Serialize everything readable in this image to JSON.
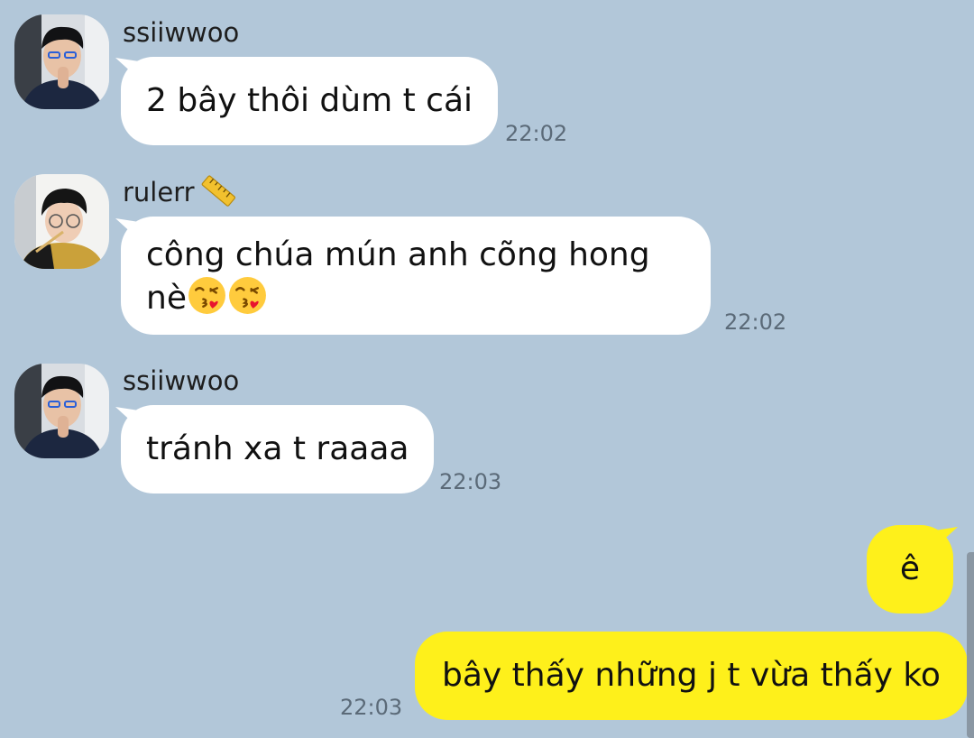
{
  "colors": {
    "background": "#b2c7d9",
    "incoming_bubble": "#ffffff",
    "outgoing_bubble": "#fef01b",
    "timestamp": "#5b6a78"
  },
  "messages": [
    {
      "sender": "ssiiwwoo",
      "text": "2 bây thôi dùm t cái",
      "time": "22:02",
      "direction": "incoming"
    },
    {
      "sender": "rulerr",
      "sender_icon": "ruler-icon",
      "text_line1": "công chúa mún anh cõng hong",
      "text_line2": "nè",
      "emoji": "face-blowing-kiss-icon",
      "time": "22:02",
      "direction": "incoming"
    },
    {
      "sender": "ssiiwwoo",
      "text": "tránh xa t raaaa",
      "time": "22:03",
      "direction": "incoming"
    },
    {
      "text": "ê",
      "direction": "outgoing"
    },
    {
      "text": "bây thấy những j t vừa thấy ko",
      "time": "22:03",
      "direction": "outgoing"
    }
  ]
}
